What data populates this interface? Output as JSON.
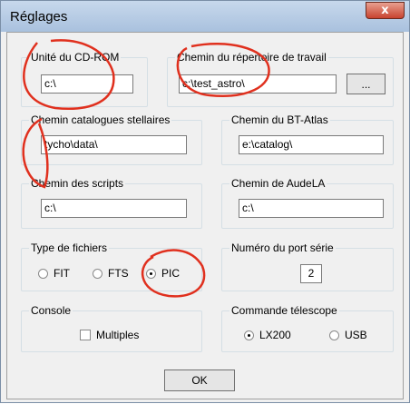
{
  "window": {
    "title": "Réglages",
    "close_label": "x"
  },
  "groups": {
    "cdrom": {
      "label": "Unité du CD-ROM",
      "value": "c:\\"
    },
    "workdir": {
      "label": "Chemin du répertoire de travail",
      "value": "c:\\test_astro\\",
      "browse_label": "..."
    },
    "catalogs": {
      "label": "Chemin catalogues stellaires",
      "value": "tycho\\data\\"
    },
    "btatlas": {
      "label": "Chemin du BT-Atlas",
      "value": "e:\\catalog\\"
    },
    "scripts": {
      "label": "Chemin des scripts",
      "value": "c:\\"
    },
    "audela": {
      "label": "Chemin de AudeLA",
      "value": "c:\\"
    },
    "filetype": {
      "label": "Type de fichiers",
      "options": [
        "FIT",
        "FTS",
        "PIC"
      ],
      "selected": "PIC"
    },
    "serialport": {
      "label": "Numéro du port série",
      "value": "2"
    },
    "console": {
      "label": "Console",
      "multiples_label": "Multiples",
      "multiples_checked": false
    },
    "telescope": {
      "label": "Commande télescope",
      "options": [
        "LX200",
        "USB"
      ],
      "selected": "LX200"
    }
  },
  "ok_label": "OK",
  "annotation_color": "#e0301e"
}
